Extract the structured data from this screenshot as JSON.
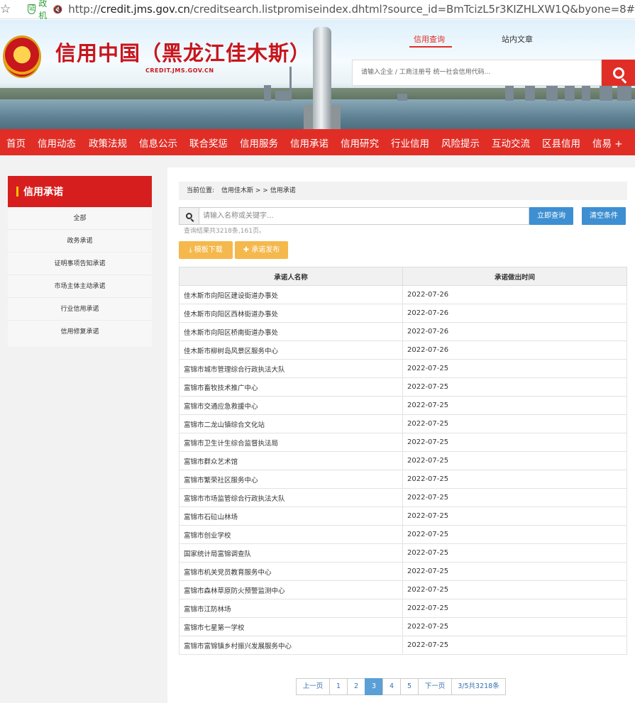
{
  "browser": {
    "badge_label": "党政机关",
    "url_prefix": "http://",
    "url_domain": "credit.jms.gov.cn",
    "url_path": "/creditsearch.listpromiseindex.dhtml?source_id=BmTcizL5r3KIZHLXW1Q&byone=8#"
  },
  "header": {
    "site_title": "信用中国（黑龙江佳木斯）",
    "site_domain": "CREDIT.JMS.GOV.CN",
    "search_tabs": [
      "信用查询",
      "站内文章"
    ],
    "search_placeholder": "请输入企业 / 工商注册号 统一社会信用代码..."
  },
  "nav": {
    "items": [
      "首页",
      "信用动态",
      "政策法规",
      "信息公示",
      "联合奖惩",
      "信用服务",
      "信用承诺",
      "信用研究",
      "行业信用",
      "风险提示",
      "互动交流",
      "区县信用",
      "信易 +"
    ]
  },
  "sidebar": {
    "title": "信用承诺",
    "items": [
      "全部",
      "政务承诺",
      "证明事项告知承诺",
      "市场主体主动承诺",
      "行业信用承诺",
      "信用修复承诺"
    ]
  },
  "breadcrumb": {
    "label": "当前位置:",
    "path": "信用佳木斯 > > 信用承诺"
  },
  "query": {
    "placeholder": "请输入名称或关键字...",
    "search_button": "立即查询",
    "clear_button": "清空条件",
    "result_note": "查询结果共3218条,161页。",
    "download_button": "模板下载",
    "publish_button": "承诺发布"
  },
  "table": {
    "headers": [
      "承诺人名称",
      "承诺做出时间"
    ],
    "rows": [
      [
        "佳木斯市向阳区建设街道办事处",
        "2022-07-26"
      ],
      [
        "佳木斯市向阳区西林街道办事处",
        "2022-07-26"
      ],
      [
        "佳木斯市向阳区桥南街道办事处",
        "2022-07-26"
      ],
      [
        "佳木斯市柳树岛风景区服务中心",
        "2022-07-26"
      ],
      [
        "富锦市城市管理综合行政执法大队",
        "2022-07-25"
      ],
      [
        "富锦市畜牧技术推广中心",
        "2022-07-25"
      ],
      [
        "富锦市交通应急救援中心",
        "2022-07-25"
      ],
      [
        "富锦市二龙山镇综合文化站",
        "2022-07-25"
      ],
      [
        "富锦市卫生计生综合监督执法局",
        "2022-07-25"
      ],
      [
        "富锦市群众艺术馆",
        "2022-07-25"
      ],
      [
        "富锦市繁荣社区服务中心",
        "2022-07-25"
      ],
      [
        "富锦市市场监管综合行政执法大队",
        "2022-07-25"
      ],
      [
        "富锦市石砬山林场",
        "2022-07-25"
      ],
      [
        "富锦市创业学校",
        "2022-07-25"
      ],
      [
        "国家统计局富锦调查队",
        "2022-07-25"
      ],
      [
        "富锦市机关党员教育服务中心",
        "2022-07-25"
      ],
      [
        "富锦市森林草原防火预警监测中心",
        "2022-07-25"
      ],
      [
        "富锦市江防林场",
        "2022-07-25"
      ],
      [
        "富锦市七星第一学校",
        "2022-07-25"
      ],
      [
        "富锦市富锦镇乡村振兴发展服务中心",
        "2022-07-25"
      ]
    ]
  },
  "pager": {
    "prev": "上一页",
    "pages": [
      "1",
      "2",
      "3",
      "4",
      "5"
    ],
    "current": "3",
    "next": "下一页",
    "summary": "3/5共3218条"
  }
}
